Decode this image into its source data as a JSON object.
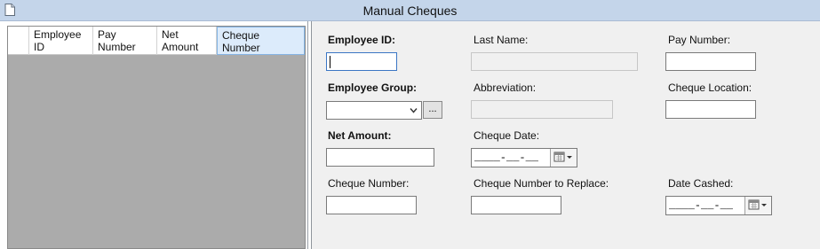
{
  "window": {
    "title": "Manual Cheques"
  },
  "grid": {
    "columns": [
      {
        "label_line1": "Employee",
        "label_line2": "ID"
      },
      {
        "label_line1": "Pay",
        "label_line2": "Number"
      },
      {
        "label_line1": "Net",
        "label_line2": "Amount"
      },
      {
        "label_line1": "Cheque",
        "label_line2": "Number"
      }
    ]
  },
  "form": {
    "employee_id": {
      "label": "Employee ID:",
      "value": ""
    },
    "last_name": {
      "label": "Last Name:",
      "value": ""
    },
    "pay_number": {
      "label": "Pay Number:",
      "value": ""
    },
    "employee_group": {
      "label": "Employee Group:",
      "value": "",
      "ellipsis": "..."
    },
    "abbreviation": {
      "label": "Abbreviation:",
      "value": ""
    },
    "cheque_location": {
      "label": "Cheque Location:",
      "value": ""
    },
    "net_amount": {
      "label": "Net Amount:",
      "value": ""
    },
    "cheque_date": {
      "label": "Cheque Date:",
      "mask": "____-__-__"
    },
    "cheque_number": {
      "label": "Cheque Number:",
      "value": ""
    },
    "cheque_number_replace": {
      "label": "Cheque Number to Replace:",
      "value": ""
    },
    "date_cashed": {
      "label": "Date Cashed:",
      "mask": "____-__-__"
    }
  },
  "icons": {
    "document": "document-icon",
    "dropdown": "chevron-down-icon",
    "calendar": "calendar-icon"
  }
}
